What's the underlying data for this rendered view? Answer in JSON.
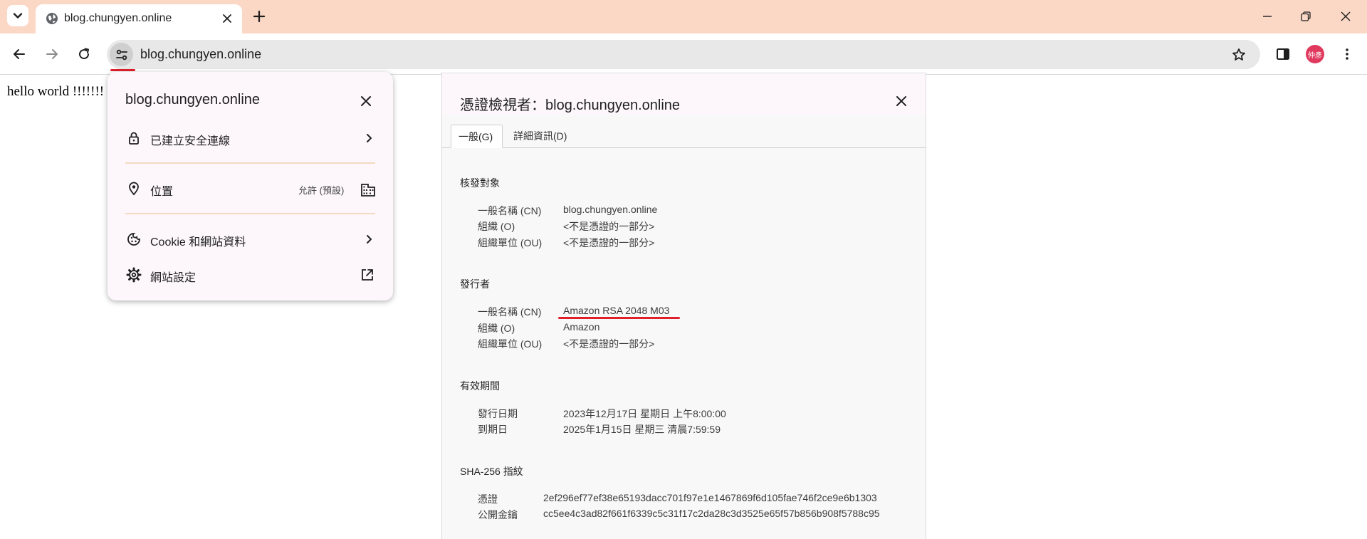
{
  "browser": {
    "tab": {
      "title": "blog.chungyen.online"
    },
    "window_controls": [
      "minimize",
      "restore",
      "close"
    ],
    "url": "blog.chungyen.online",
    "profile_initials": "仲彥"
  },
  "page": {
    "body_text": "hello world !!!!!!!"
  },
  "site_info_popup": {
    "title": "blog.chungyen.online",
    "rows": [
      {
        "icon": "lock-icon",
        "label": "已建立安全連線"
      },
      {
        "icon": "location-pin-icon",
        "label": "位置",
        "value": "允許 (預設)"
      },
      {
        "icon": "cookie-icon",
        "label": "Cookie 和網站資料"
      },
      {
        "icon": "gear-icon",
        "label": "網站設定"
      }
    ]
  },
  "cert_viewer": {
    "title": "憑證檢視者：blog.chungyen.online",
    "tabs": [
      "一般(G)",
      "詳細資訊(D)"
    ],
    "issued_to": {
      "title": "核發對象",
      "fields": [
        {
          "label": "一般名稱 (CN)",
          "value": "blog.chungyen.online"
        },
        {
          "label": "組織 (O)",
          "value": "<不是憑證的一部分>"
        },
        {
          "label": "組織單位 (OU)",
          "value": "<不是憑證的一部分>"
        }
      ]
    },
    "issued_by": {
      "title": "發行者",
      "fields": [
        {
          "label": "一般名稱 (CN)",
          "value": "Amazon RSA 2048 M03"
        },
        {
          "label": "組織 (O)",
          "value": "Amazon"
        },
        {
          "label": "組織單位 (OU)",
          "value": "<不是憑證的一部分>"
        }
      ]
    },
    "validity": {
      "title": "有效期間",
      "fields": [
        {
          "label": "發行日期",
          "value": "2023年12月17日 星期日 上午8:00:00"
        },
        {
          "label": "到期日",
          "value": "2025年1月15日 星期三 清晨7:59:59"
        }
      ]
    },
    "fingerprints": {
      "title": "SHA-256 指紋",
      "fields": [
        {
          "label": "憑證",
          "value": "2ef296ef77ef38e65193dacc701f97e1e1467869f6d105fae746f2ce9e6b1303"
        },
        {
          "label": "公開金鑰",
          "value": "cc5ee4c3ad82f661f6339c5c31f17c2da28c3d3525e65f57b856b908f5788c95"
        }
      ]
    }
  },
  "colors": {
    "tabstrip": "#fbd7c6",
    "annotation_red": "#e0202c",
    "avatar": "#e0395e",
    "popup_bg": "#fdf7fb"
  }
}
